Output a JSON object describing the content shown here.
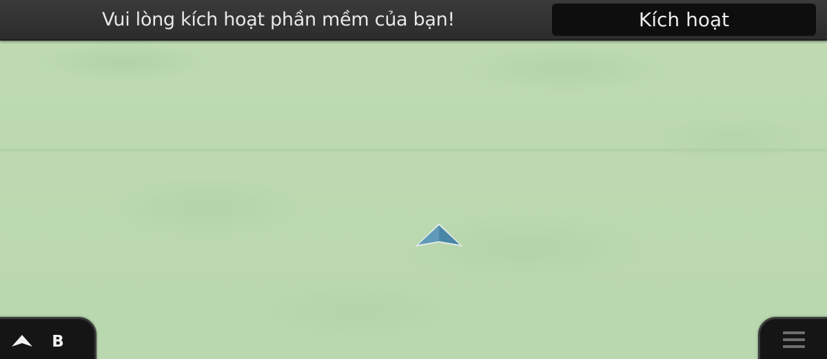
{
  "topbar": {
    "message": "Vui lòng kích hoạt phần mềm của bạn!",
    "activate_label": "Kích hoạt"
  },
  "map": {
    "background_color": "#bcd9b1",
    "position_marker_icon": "navigation-arrow-icon"
  },
  "bottom_left": {
    "compass_icon": "north-arrow-icon",
    "heading": "B"
  },
  "bottom_right": {
    "menu_icon": "hamburger-menu-icon"
  },
  "colors": {
    "topbar": "#2f2f2f",
    "button": "#0e0e0e",
    "panel": "#151515",
    "marker": "#4a86a6"
  }
}
